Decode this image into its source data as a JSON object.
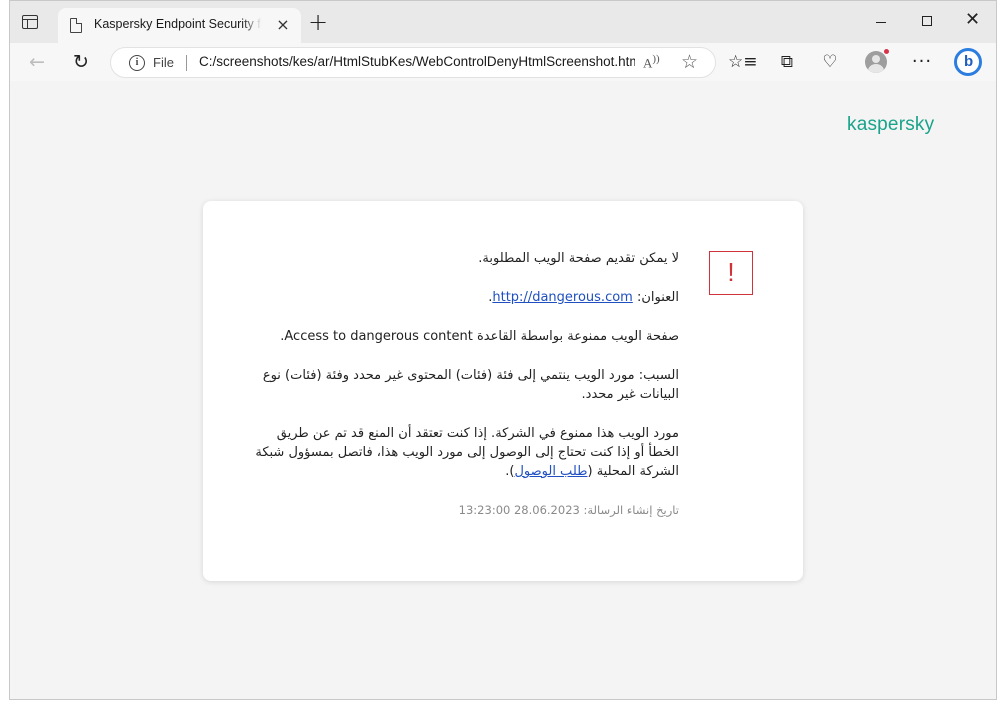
{
  "browser": {
    "tab_title": "Kaspersky Endpoint Security for Windows",
    "tab_close": "×",
    "new_tab": "+",
    "address": {
      "scheme": "File",
      "url": "C:/screenshots/kes/ar/HtmlStubKes/WebControlDenyHtmlScreenshot.html",
      "read_aloud": "A)"
    },
    "window_close": "✕",
    "more": "···"
  },
  "page": {
    "brand": "kaspersky",
    "alert_symbol": "!",
    "heading": "لا يمكن تقديم صفحة الويب المطلوبة.",
    "address_label": "العنوان: ",
    "address_url": "http://dangerous.com",
    "address_end": ".",
    "rule_prefix": "صفحة الويب ممنوعة بواسطة القاعدة ",
    "rule_name": "Access to dangerous content",
    "rule_end": ".",
    "reason": "السبب: مورد الويب ينتمي إلى فئة (فئات) المحتوى غير محدد وفئة (فئات) نوع البيانات غير محدد.",
    "contact_text": "مورد الويب هذا ممنوع في الشركة. إذا كنت تعتقد أن المنع قد تم عن طريق الخطأ أو إذا كنت تحتاج إلى الوصول إلى مورد الويب هذا، فاتصل بمسؤول شبكة الشركة المحلية (",
    "request_link": "طلب الوصول",
    "contact_end": ").",
    "timestamp": "تاريخ إنشاء الرسالة: 28.06.2023 13:23:00"
  }
}
